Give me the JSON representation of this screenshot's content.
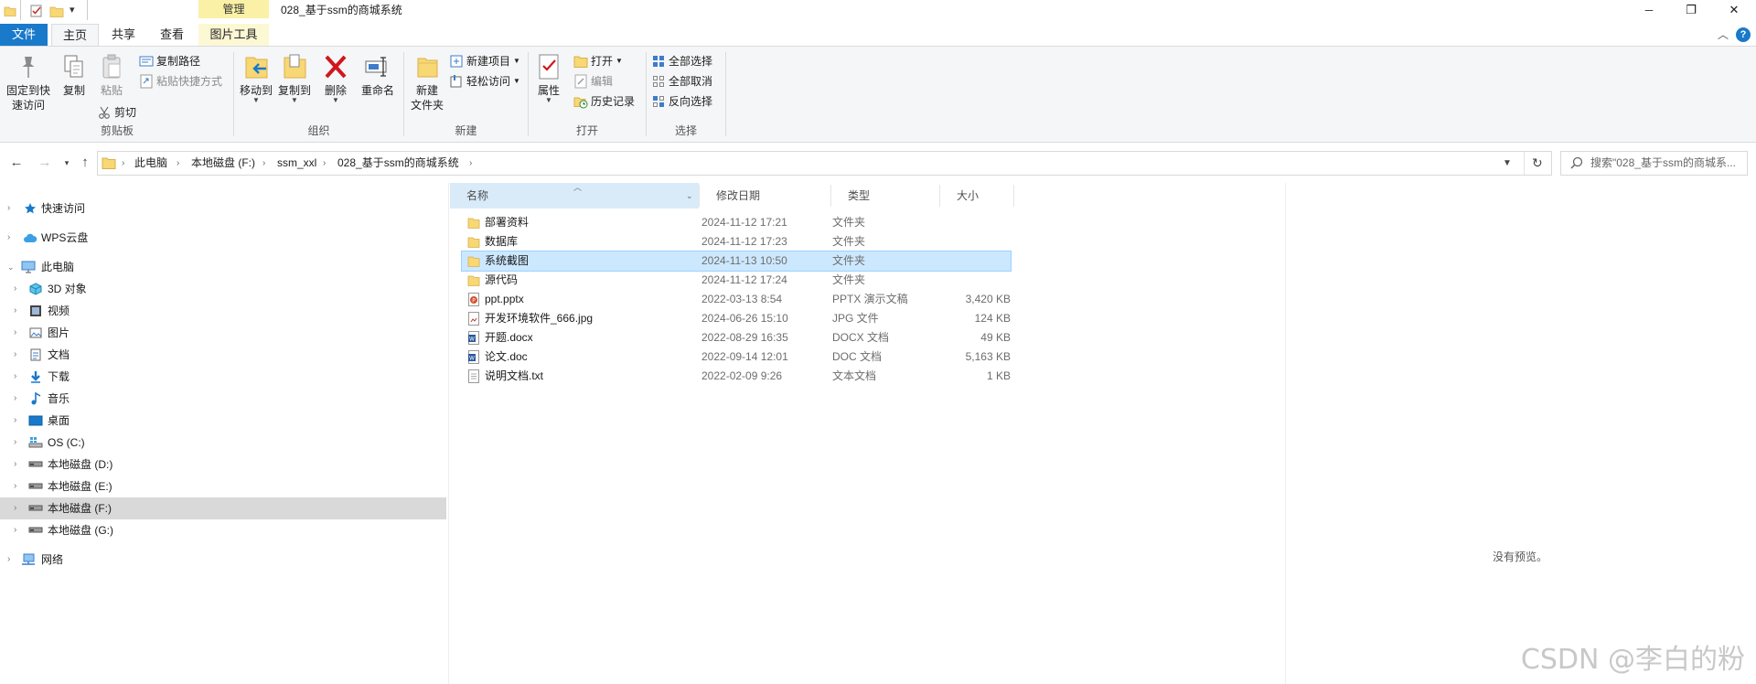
{
  "window": {
    "title": "028_基于ssm的商城系统",
    "context_tab": "管理",
    "controls": {
      "minimize": "─",
      "maximize": "❐",
      "close": "✕"
    },
    "collapse_ribbon": "︿",
    "help": "?"
  },
  "tabs": [
    {
      "label": "文件",
      "active": "file"
    },
    {
      "label": "主页",
      "active": "selected"
    },
    {
      "label": "共享",
      "active": "no"
    },
    {
      "label": "查看",
      "active": "no"
    },
    {
      "label": "图片工具",
      "active": "no"
    }
  ],
  "ribbon": {
    "clipboard": {
      "pin_label_1": "固定到快",
      "pin_label_2": "速访问",
      "copy": "复制",
      "paste": "粘贴",
      "copy_path": "复制路径",
      "paste_shortcut": "粘贴快捷方式",
      "cut": "剪切",
      "group": "剪贴板"
    },
    "organize": {
      "move_to": "移动到",
      "copy_to": "复制到",
      "delete": "删除",
      "rename": "重命名",
      "group": "组织"
    },
    "new": {
      "new_folder_1": "新建",
      "new_folder_2": "文件夹",
      "new_item": "新建项目",
      "easy_access": "轻松访问",
      "group": "新建"
    },
    "open": {
      "properties": "属性",
      "open": "打开",
      "edit": "编辑",
      "history": "历史记录",
      "group": "打开"
    },
    "select": {
      "select_all": "全部选择",
      "select_none": "全部取消",
      "invert": "反向选择",
      "group": "选择"
    }
  },
  "address": {
    "crumbs": [
      "此电脑",
      "本地磁盘 (F:)",
      "ssm_xxl",
      "028_基于ssm的商城系统"
    ],
    "search_placeholder": "搜索\"028_基于ssm的商城系..."
  },
  "nav_pane": [
    {
      "label": "快速访问",
      "icon": "star-icon",
      "level": 0
    },
    {
      "label": "WPS云盘",
      "icon": "cloud-icon",
      "level": 0
    },
    {
      "label": "此电脑",
      "icon": "pc-icon",
      "level": 0
    },
    {
      "label": "3D 对象",
      "icon": "cube-icon",
      "level": 1
    },
    {
      "label": "视频",
      "icon": "video-icon",
      "level": 1
    },
    {
      "label": "图片",
      "icon": "picture-icon",
      "level": 1
    },
    {
      "label": "文档",
      "icon": "document-icon",
      "level": 1
    },
    {
      "label": "下载",
      "icon": "download-icon",
      "level": 1
    },
    {
      "label": "音乐",
      "icon": "music-icon",
      "level": 1
    },
    {
      "label": "桌面",
      "icon": "desktop-icon",
      "level": 1
    },
    {
      "label": "OS (C:)",
      "icon": "os-drive-icon",
      "level": 1
    },
    {
      "label": "本地磁盘 (D:)",
      "icon": "drive-icon",
      "level": 1
    },
    {
      "label": "本地磁盘 (E:)",
      "icon": "drive-icon",
      "level": 1
    },
    {
      "label": "本地磁盘 (F:)",
      "icon": "drive-icon",
      "level": 1
    },
    {
      "label": "本地磁盘 (G:)",
      "icon": "drive-icon",
      "level": 1
    },
    {
      "label": "网络",
      "icon": "network-icon",
      "level": 0
    }
  ],
  "columns": {
    "name": "名称",
    "modified": "修改日期",
    "type": "类型",
    "size": "大小"
  },
  "files": [
    {
      "name": "部署资料",
      "modified": "2024-11-12 17:21",
      "type": "文件夹",
      "size": "",
      "icon": "folder-icon"
    },
    {
      "name": "数据库",
      "modified": "2024-11-12 17:23",
      "type": "文件夹",
      "size": "",
      "icon": "folder-icon"
    },
    {
      "name": "系统截图",
      "modified": "2024-11-13 10:50",
      "type": "文件夹",
      "size": "",
      "icon": "folder-icon"
    },
    {
      "name": "源代码",
      "modified": "2024-11-12 17:24",
      "type": "文件夹",
      "size": "",
      "icon": "folder-icon"
    },
    {
      "name": "ppt.pptx",
      "modified": "2022-03-13 8:54",
      "type": "PPTX 演示文稿",
      "size": "3,420 KB",
      "icon": "pptx-icon"
    },
    {
      "name": "开发环境软件_666.jpg",
      "modified": "2024-06-26 15:10",
      "type": "JPG 文件",
      "size": "124 KB",
      "icon": "jpg-icon"
    },
    {
      "name": "开题.docx",
      "modified": "2022-08-29 16:35",
      "type": "DOCX 文档",
      "size": "49 KB",
      "icon": "docx-icon"
    },
    {
      "name": "论文.doc",
      "modified": "2022-09-14 12:01",
      "type": "DOC 文档",
      "size": "5,163 KB",
      "icon": "doc-icon"
    },
    {
      "name": "说明文档.txt",
      "modified": "2022-02-09 9:26",
      "type": "文本文档",
      "size": "1 KB",
      "icon": "txt-icon"
    }
  ],
  "selected_file": "系统截图",
  "selected_nav": "本地磁盘 (F:)",
  "preview": {
    "empty": "没有预览。"
  },
  "watermark": "CSDN @李白的粉",
  "colors": {
    "accent": "#1979ca",
    "selection": "#cce8ff",
    "selection_border": "#99d1ff",
    "folder": "#f8d775",
    "context_tab": "#fbf1a6",
    "file_tab": "#1979ca"
  }
}
